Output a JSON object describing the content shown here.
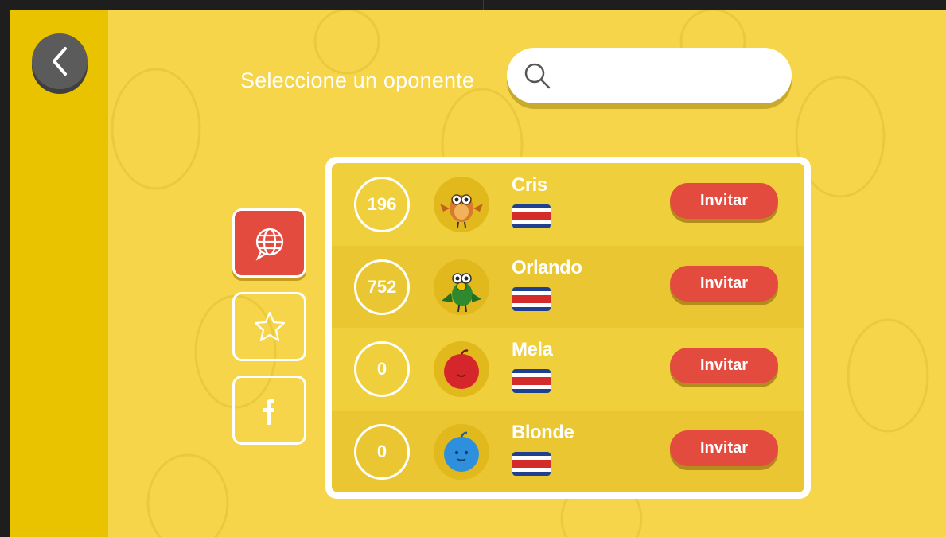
{
  "header": {
    "prompt": "Seleccione un oponente"
  },
  "search": {
    "placeholder": ""
  },
  "tabs": [
    {
      "name": "world",
      "icon": "globe-chat-icon",
      "active": true
    },
    {
      "name": "favorites",
      "icon": "star-icon",
      "active": false
    },
    {
      "name": "facebook",
      "icon": "facebook-icon",
      "active": false
    }
  ],
  "players": [
    {
      "score": "196",
      "name": "Cris",
      "avatar": "owl-icon",
      "flag": "costa-rica-flag",
      "action": "Invitar"
    },
    {
      "score": "752",
      "name": "Orlando",
      "avatar": "parrot-icon",
      "flag": "costa-rica-flag",
      "action": "Invitar"
    },
    {
      "score": "0",
      "name": "Mela",
      "avatar": "red-ball-icon",
      "flag": "costa-rica-flag",
      "action": "Invitar"
    },
    {
      "score": "0",
      "name": "Blonde",
      "avatar": "blue-ball-icon",
      "flag": "costa-rica-flag",
      "action": "Invitar"
    }
  ],
  "colors": {
    "background": "#f6d54a",
    "accent": "#e44b3f",
    "strip": "#e9c200"
  }
}
